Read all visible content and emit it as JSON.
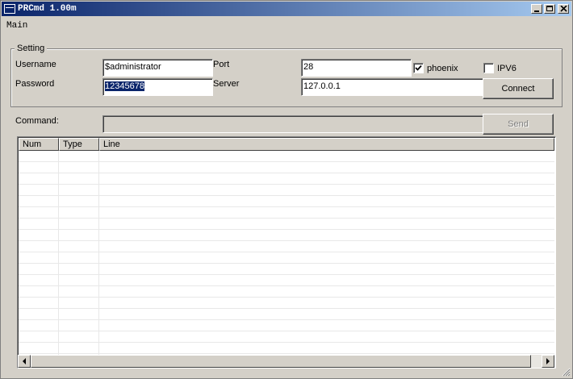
{
  "window": {
    "title": "PRCmd 1.00m"
  },
  "menu": {
    "main": "Main"
  },
  "setting": {
    "group_label": "Setting",
    "username_label": "Username",
    "username_value": "$administrator",
    "password_label": "Password",
    "password_value": "12345678",
    "port_label": "Port",
    "port_value": "28",
    "server_label": "Server",
    "server_value": "127.0.0.1",
    "phoenix_label": "phoenix",
    "phoenix_checked": true,
    "ipv6_label": "IPV6",
    "ipv6_checked": false,
    "connect_label": "Connect"
  },
  "command": {
    "label": "Command:",
    "value": "",
    "send_label": "Send"
  },
  "results": {
    "columns": [
      "Num",
      "Type",
      "Line"
    ],
    "rows": []
  },
  "colors": {
    "titlebar_start": "#0a246a",
    "titlebar_end": "#a6caf0",
    "face": "#d4d0c8",
    "selection": "#0a246a"
  }
}
